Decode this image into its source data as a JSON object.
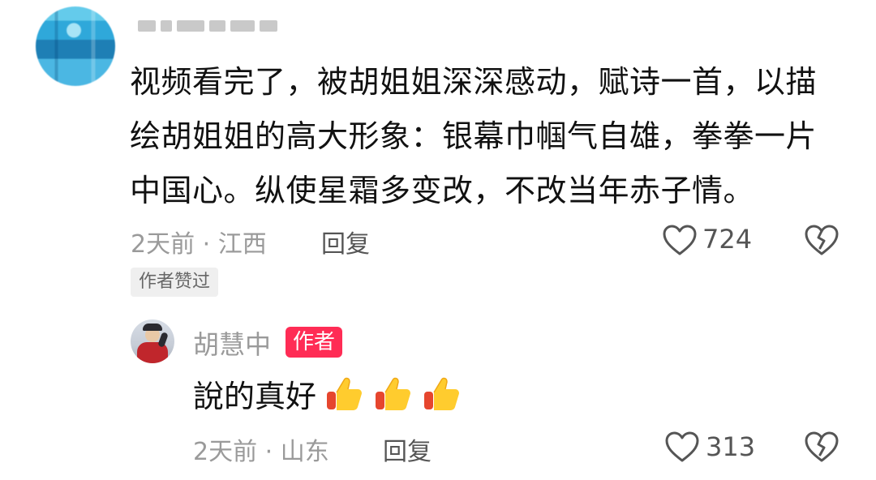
{
  "comment": {
    "text": "视频看完了，被胡姐姐深深感动，赋诗一首，以描绘胡姐姐的高大形象：银幕巾帼气自雄，拳拳一片中国心。纵使星霜多变改，不改当年赤子情。",
    "time_location": "2天前 · 江西",
    "reply_label": "回复",
    "like_count": "724",
    "author_liked_badge": "作者赞过"
  },
  "reply": {
    "username": "胡慧中",
    "author_tag": "作者",
    "text": "說的真好",
    "emoji_icons": [
      "thumbs-up-icon",
      "thumbs-up-icon",
      "thumbs-up-icon"
    ],
    "time_location": "2天前 · 山东",
    "reply_label": "回复",
    "like_count": "313"
  },
  "colors": {
    "author_tag_bg": "#ff2c55",
    "meta_text": "#9a9a9a",
    "body_text": "#111111"
  }
}
